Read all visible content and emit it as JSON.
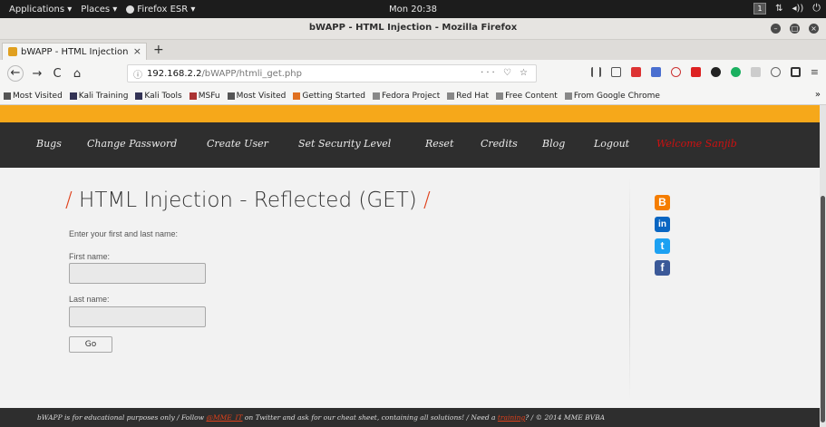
{
  "topbar": {
    "applications": "Applications ▾",
    "places": "Places ▾",
    "firefox": "Firefox ESR ▾",
    "clock": "Mon 20:38",
    "workspace": "1"
  },
  "window": {
    "title": "bWAPP - HTML Injection - Mozilla Firefox"
  },
  "tab": {
    "label": "bWAPP - HTML Injection",
    "close": "×",
    "new_tab": "+"
  },
  "nav": {
    "back": "←",
    "forward": "→",
    "reload": "C",
    "home": "⌂",
    "url_prefix": "ⓘ",
    "url_host": "192.168.2.2",
    "url_path": "/bWAPP/htmli_get.php",
    "url_actions": "··· ♡ ☆"
  },
  "bookmarks": [
    {
      "label": "Most Visited",
      "color": "#555"
    },
    {
      "label": "Kali Training",
      "color": "#335"
    },
    {
      "label": "Kali Tools",
      "color": "#335"
    },
    {
      "label": "MSFu",
      "color": "#a33"
    },
    {
      "label": "Most Visited",
      "color": "#555"
    },
    {
      "label": "Getting Started",
      "color": "#e07020"
    },
    {
      "label": "Fedora Project",
      "color": "#888"
    },
    {
      "label": "Red Hat",
      "color": "#888"
    },
    {
      "label": "Free Content",
      "color": "#888"
    },
    {
      "label": "From Google Chrome",
      "color": "#888"
    }
  ],
  "bookmarks_overflow": "»",
  "menu": {
    "items": [
      "Bugs",
      "Change Password",
      "Create User",
      "Set Security Level",
      "Reset",
      "Credits",
      "Blog",
      "Logout"
    ],
    "welcome": "Welcome Sanjib"
  },
  "heading": {
    "slash_left": "/",
    "text": " HTML Injection - Reflected (GET) ",
    "slash_right": "/"
  },
  "form": {
    "intro": "Enter your first and last name:",
    "first_label": "First name:",
    "first_value": "",
    "last_label": "Last name:",
    "last_value": "",
    "go": "Go"
  },
  "social": [
    {
      "name": "blogger",
      "glyph": "B",
      "color": "#f57d00"
    },
    {
      "name": "linkedin",
      "glyph": "in",
      "color": "#0a66c2"
    },
    {
      "name": "twitter",
      "glyph": "t",
      "color": "#1da1f2"
    },
    {
      "name": "facebook",
      "glyph": "f",
      "color": "#3b5998"
    }
  ],
  "footer": {
    "part1": "bWAPP is for educational purposes only / Follow ",
    "link1": "@MME_IT",
    "part2": " on Twitter and ask for our cheat sheet, containing all solutions! / Need a ",
    "link2": "training",
    "part3": "? / © 2014 MME BVBA"
  }
}
